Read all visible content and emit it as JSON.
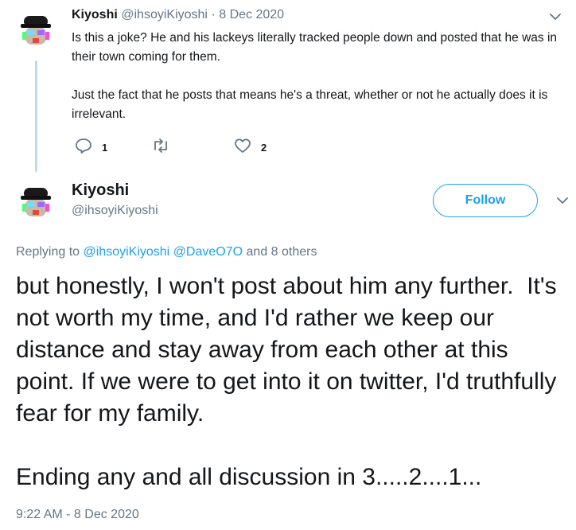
{
  "parent_tweet": {
    "name": "Kiyoshi",
    "handle": "@ihsoyiKiyoshi",
    "separator": "·",
    "date": "8 Dec 2020",
    "paragraphs": [
      "Is this a joke? He and his lackeys literally tracked people down and posted that he was in their town coming for them.",
      "Just the fact that he posts that means he's a threat, whether or not he actually does it is irrelevant."
    ],
    "reply_count": "1",
    "like_count": "2",
    "icons": [
      "reply-icon",
      "retweet-icon",
      "like-icon",
      "chevron-down-icon"
    ]
  },
  "main_tweet": {
    "name": "Kiyoshi",
    "handle": "@ihsoyiKiyoshi",
    "follow_label": "Follow",
    "replying_prefix": "Replying to",
    "mention_1": "@ihsoyiKiyoshi",
    "mention_2": "@DaveO7O",
    "replying_suffix": "and 8 others",
    "text": "but honestly, I won't post about him any further.  It's not worth my time, and I'd rather we keep our distance and stay away from each other at this point. If we were to get into it on twitter, I'd truthfully fear for my family.\n\nEnding any and all discussion in 3.....2....1...",
    "timestamp": "9:22 AM - 8 Dec 2020"
  },
  "colors": {
    "accent": "#1da1f2",
    "secondary_text": "#657786",
    "primary_text": "#14171a",
    "thread_line": "#bfd9f0"
  }
}
